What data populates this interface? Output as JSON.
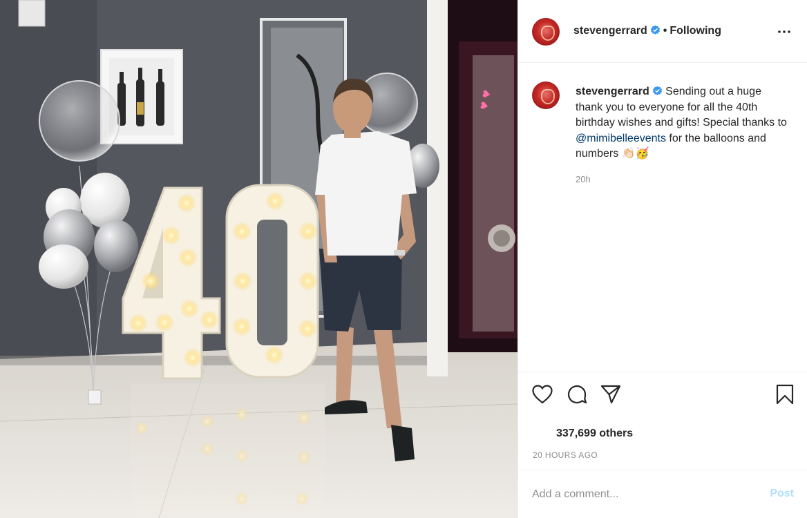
{
  "post": {
    "username": "stevengerrard",
    "follow_status": "Following",
    "caption_before_mention": "Sending out a huge thank you to everyone for all the 40th birthday wishes and gifts! Special thanks to ",
    "mention": "@mimibelleevents",
    "caption_after_mention": " for the balloons and numbers 👏🏻🥳",
    "relative_time": "20h",
    "likes_text": "337,699 others",
    "date_text": "20 HOURS AGO"
  },
  "photo": {
    "number_sign": "40"
  },
  "comment_box": {
    "placeholder": "Add a comment...",
    "post_label": "Post"
  },
  "icons": {
    "verified": "verified-badge-icon",
    "more": "more-options-icon",
    "like": "heart-icon",
    "comment": "comment-bubble-icon",
    "share": "paper-plane-icon",
    "save": "bookmark-icon"
  },
  "colors": {
    "verified_blue": "#3897f0",
    "mention_blue": "#00376b",
    "post_button_disabled": "#b2dffc",
    "secondary_text": "#8e8e8e"
  }
}
